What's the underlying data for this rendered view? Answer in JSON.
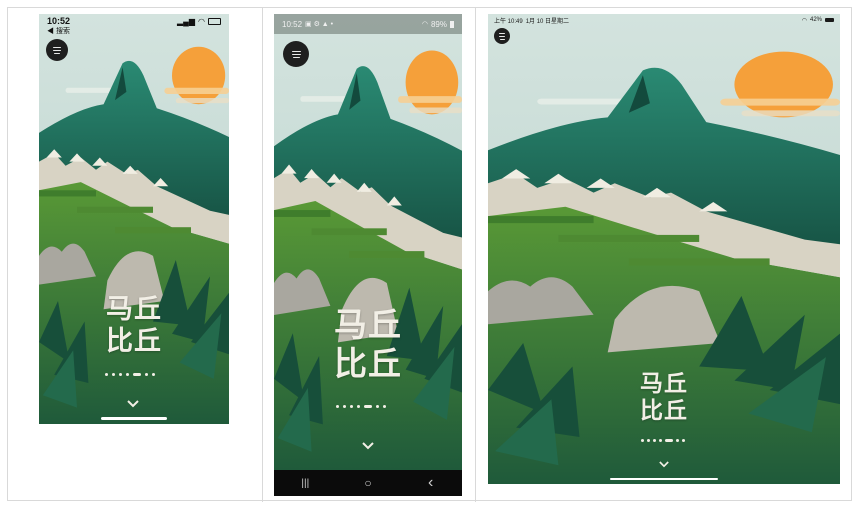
{
  "colors": {
    "sky": "#c9ddd8",
    "sun": "#f5a03a",
    "mountain": "#1f6e5e",
    "grass": "#3f7d2c",
    "stone": "#d8d3c4",
    "text": "#f2efe6"
  },
  "phone1": {
    "status": {
      "time": "10:52",
      "back": "◀ 搜索"
    },
    "title_line1": "马丘",
    "title_line2": "比丘",
    "menu_icon": "menu-icon",
    "chevron_icon": "chevron-down-icon"
  },
  "phone2": {
    "status": {
      "time": "10:52",
      "battery": "89%"
    },
    "title_line1": "马丘",
    "title_line2": "比丘",
    "menu_icon": "menu-icon",
    "chevron_icon": "chevron-down-icon",
    "navbar": {
      "recents": "|||",
      "home": "○",
      "back": "‹"
    }
  },
  "tablet": {
    "status": {
      "time": "上午 10:49",
      "date": "1月 10 日星期二",
      "battery": "42%"
    },
    "title_line1": "马丘",
    "title_line2": "比丘",
    "menu_icon": "menu-icon",
    "chevron_icon": "chevron-down-icon"
  }
}
